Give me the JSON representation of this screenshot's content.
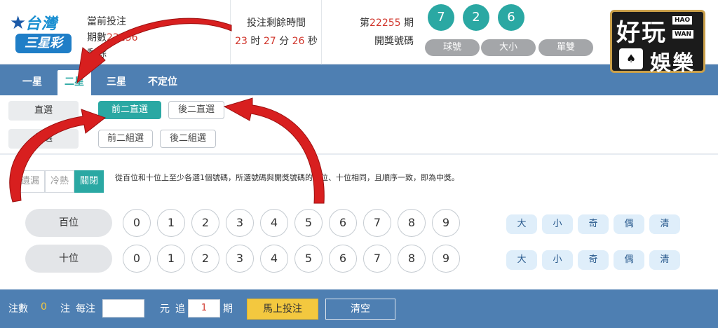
{
  "logo": {
    "line1": "台灣",
    "line2": "三星彩"
  },
  "header": {
    "current_bet_label": "當前投注",
    "period_label": "期數",
    "period_value": "22256",
    "remaining_label": "剩餘",
    "timer_label": "投注剩餘時間",
    "timer": {
      "hours": "23",
      "h_unit": "时",
      "minutes": "27",
      "m_unit": "分",
      "seconds": "26",
      "s_unit": "秒"
    },
    "draw_prefix": "第",
    "draw_number": "22255",
    "draw_suffix": "期",
    "draw_label": "開獎號碼"
  },
  "balls": [
    "7",
    "2",
    "6"
  ],
  "ball_filters": [
    "球號",
    "大小",
    "單雙"
  ],
  "brand": {
    "cn1": "好玩",
    "cn2": "娛樂",
    "en1": "HAO",
    "en2": "WAN",
    "cards": "♠"
  },
  "tabs": [
    "一星",
    "二星",
    "三星",
    "不定位"
  ],
  "sub": {
    "direct_label": "直選",
    "group_label": "組選",
    "direct_options": [
      "前二直選",
      "後二直選"
    ],
    "group_options": [
      "前二組選",
      "後二組選"
    ]
  },
  "segments": [
    "遺漏",
    "冷熱",
    "關閉"
  ],
  "description": "從百位和十位上至少各選1個號碼，所選號碼與開獎號碼的百位、十位相同，且順序一致，即為中獎。",
  "rows": [
    {
      "label": "百位"
    },
    {
      "label": "十位"
    }
  ],
  "numbers": [
    "0",
    "1",
    "2",
    "3",
    "4",
    "5",
    "6",
    "7",
    "8",
    "9"
  ],
  "quick": [
    "大",
    "小",
    "奇",
    "偶",
    "清"
  ],
  "footer": {
    "bets_label": "注數",
    "bets_value": "0",
    "bets_unit": "注",
    "per_bet_label": "每注",
    "per_bet_value": "",
    "yuan_label": "元",
    "chase_label": "追",
    "chase_value": "1",
    "period_unit": "期",
    "bet_now": "馬上投注",
    "clear": "清空"
  },
  "colors": {
    "teal": "#2aa8a3",
    "blue_bar": "#4e7fb2",
    "red_text": "#d0352b",
    "yellow_button": "#f3c83f",
    "arrow_red": "#d81f1f"
  }
}
